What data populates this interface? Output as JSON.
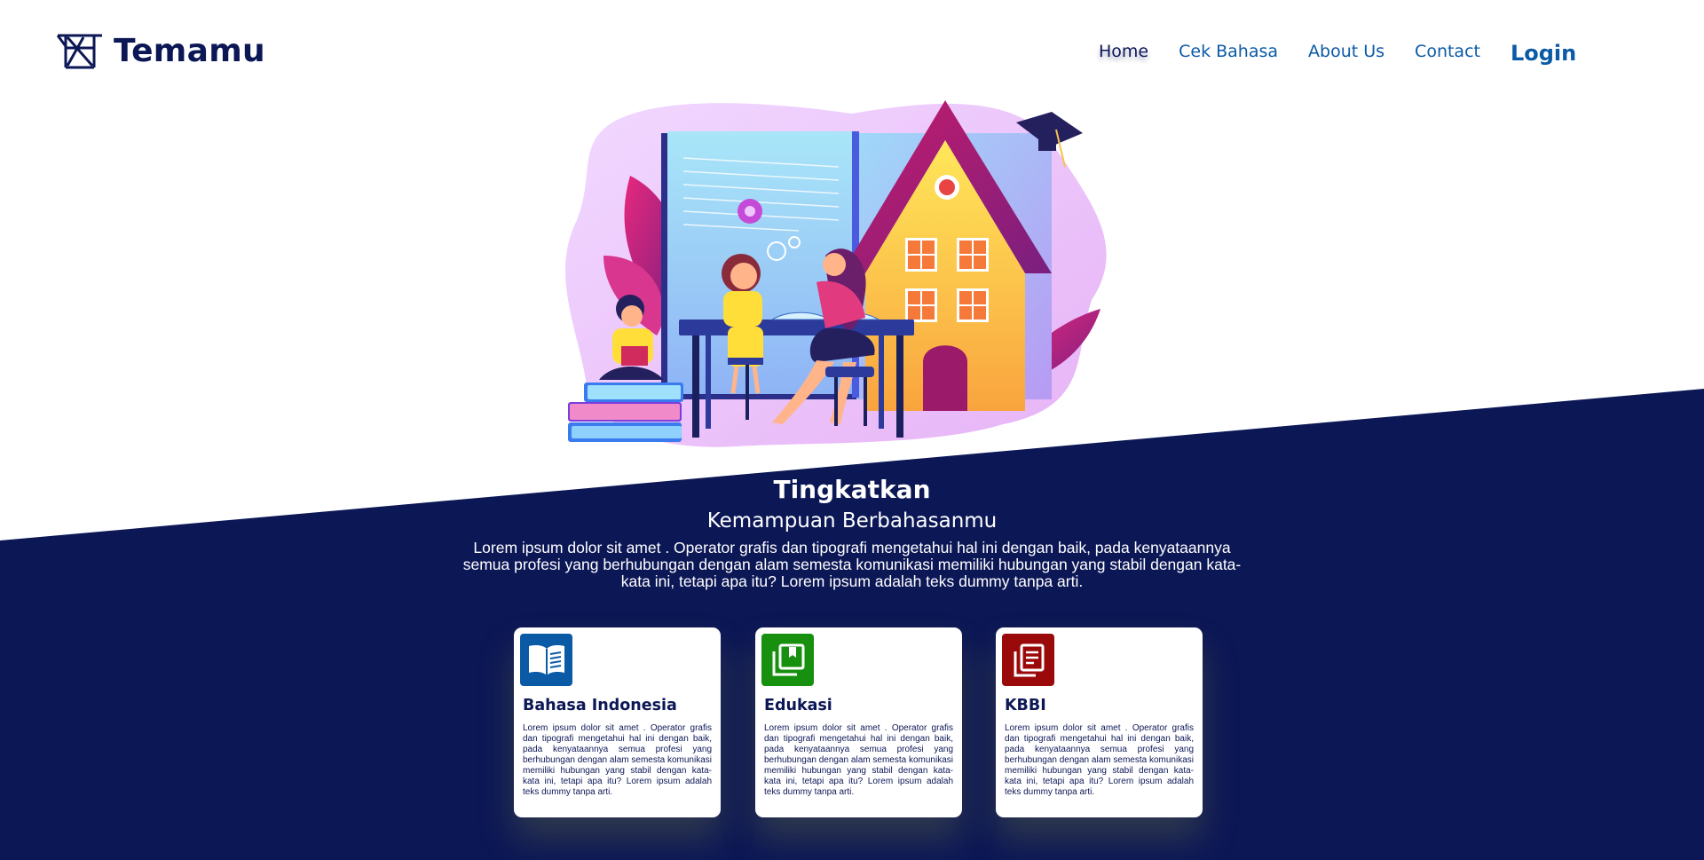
{
  "brand": {
    "name": "Temamu"
  },
  "nav": {
    "items": [
      {
        "label": "Home",
        "active": true
      },
      {
        "label": "Cek Bahasa"
      },
      {
        "label": "About Us"
      },
      {
        "label": "Contact"
      }
    ],
    "login_label": "Login"
  },
  "hero": {
    "title": "Tingkatkan",
    "subtitle": "Kemampuan Berbahasanmu",
    "description": "Lorem ipsum dolor sit amet . Operator grafis dan tipografi mengetahui hal ini dengan baik, pada kenyataannya semua profesi yang berhubungan dengan alam semesta komunikasi memiliki hubungan yang stabil dengan kata-kata ini, tetapi apa itu? Lorem ipsum adalah teks dummy tanpa arti."
  },
  "cards": [
    {
      "title": "Bahasa Indonesia",
      "icon": "book-open-icon",
      "color": "#0b5aa6",
      "body": "Lorem ipsum dolor sit amet . Operator grafis dan tipografi mengetahui hal ini dengan baik, pada kenyataannya semua profesi yang berhubungan dengan alam semesta komunikasi memiliki hubungan yang stabil dengan kata-kata ini, tetapi apa itu? Lorem ipsum adalah teks dummy tanpa arti."
    },
    {
      "title": "Edukasi",
      "icon": "library-books-icon",
      "color": "#17900f",
      "body": "Lorem ipsum dolor sit amet . Operator grafis dan tipografi mengetahui hal ini dengan baik, pada kenyataannya semua profesi yang berhubungan dengan alam semesta komunikasi memiliki hubungan yang stabil dengan kata-kata ini, tetapi apa itu? Lorem ipsum adalah teks dummy tanpa arti."
    },
    {
      "title": "KBBI",
      "icon": "document-stack-icon",
      "color": "#9b0a0a",
      "body": "Lorem ipsum dolor sit amet . Operator grafis dan tipografi mengetahui hal ini dengan baik, pada kenyataannya semua profesi yang berhubungan dengan alam semesta komunikasi memiliki hubungan yang stabil dengan kata-kata ini, tetapi apa itu? Lorem ipsum adalah teks dummy tanpa arti."
    }
  ],
  "colors": {
    "navy": "#0c1756",
    "link": "#0b5aa6",
    "white": "#ffffff"
  }
}
